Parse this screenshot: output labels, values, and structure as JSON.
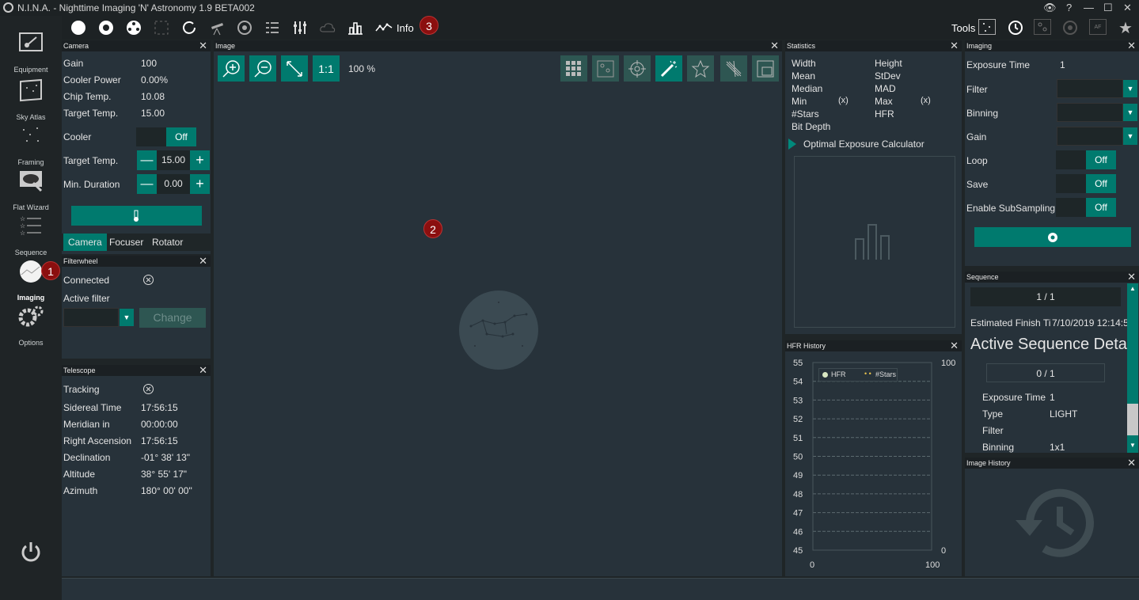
{
  "window": {
    "title": "N.I.N.A. - Nighttime Imaging 'N' Astronomy 1.9 BETA002",
    "controls": [
      "eye",
      "?",
      "—",
      "☐",
      "✕"
    ]
  },
  "sidebar": {
    "items": [
      {
        "label": "Equipment",
        "icon": "camera-plug-icon"
      },
      {
        "label": "Sky Atlas",
        "icon": "sky-atlas-icon"
      },
      {
        "label": "Framing",
        "icon": "framing-icon"
      },
      {
        "label": "Flat Wizard",
        "icon": "flat-wizard-icon"
      },
      {
        "label": "Sequence",
        "icon": "sequence-icon"
      },
      {
        "label": "Imaging",
        "icon": "imaging-icon"
      },
      {
        "label": "Options",
        "icon": "gears-icon"
      }
    ],
    "power_icon": "power-icon"
  },
  "toolbar": {
    "info_label": "Info",
    "tools_label": "Tools"
  },
  "badges": {
    "b1": "1",
    "b2": "2",
    "b3": "3"
  },
  "camera": {
    "title": "Camera",
    "rows": [
      {
        "k": "Gain",
        "v": "100"
      },
      {
        "k": "Cooler Power",
        "v": "0.00%"
      },
      {
        "k": "Chip Temp.",
        "v": "10.08"
      },
      {
        "k": "Target Temp.",
        "v": "15.00"
      }
    ],
    "cooler_label": "Cooler",
    "cooler_state": "Off",
    "target_label": "Target Temp.",
    "target_value": "15.00",
    "minduration_label": "Min. Duration",
    "minduration_value": "0.00",
    "tabs": [
      "Camera",
      "Focuser",
      "Rotator"
    ]
  },
  "filterwheel": {
    "title": "Filterwheel",
    "connected_label": "Connected",
    "active_label": "Active filter",
    "change_label": "Change"
  },
  "telescope": {
    "title": "Telescope",
    "rows": [
      {
        "k": "Tracking",
        "v": ""
      },
      {
        "k": "Sidereal Time",
        "v": "17:56:15"
      },
      {
        "k": "Meridian in",
        "v": "00:00:00"
      },
      {
        "k": "Right Ascension",
        "v": "17:56:15"
      },
      {
        "k": "Declination",
        "v": "-01° 38' 13\""
      },
      {
        "k": "Altitude",
        "v": "38° 55' 17\""
      },
      {
        "k": "Azimuth",
        "v": "180° 00' 00\""
      }
    ]
  },
  "image": {
    "title": "Image",
    "zoom_label": "1:1",
    "zoom_percent": "100 %"
  },
  "statistics": {
    "title": "Statistics",
    "left": [
      "Width",
      "Mean",
      "Median",
      "Min",
      "#Stars",
      "Bit Depth"
    ],
    "min_x": "(x)",
    "right": [
      "Height",
      "StDev",
      "MAD",
      "Max",
      "HFR"
    ],
    "max_x": "(x)",
    "calc_label": "Optimal Exposure Calculator"
  },
  "hfr": {
    "title": "HFR History",
    "legend": [
      "HFR",
      "#Stars"
    ]
  },
  "chart_data": {
    "type": "line",
    "title": "HFR History",
    "series": [
      {
        "name": "HFR",
        "values": []
      },
      {
        "name": "#Stars",
        "values": []
      }
    ],
    "y_ticks": [
      "55",
      "54",
      "53",
      "52",
      "51",
      "50",
      "49",
      "48",
      "47",
      "46",
      "45"
    ],
    "y2_ticks": [
      "100",
      "0"
    ],
    "x_ticks": [
      "0",
      "100"
    ],
    "ylim": [
      45,
      55
    ],
    "y2lim": [
      0,
      100
    ],
    "xlim": [
      0,
      100
    ],
    "grid": true,
    "legend": "top-left"
  },
  "imaging": {
    "title": "Imaging",
    "exposure_label": "Exposure Time",
    "exposure_value": "1",
    "filter_label": "Filter",
    "binning_label": "Binning",
    "gain_label": "Gain",
    "loop_label": "Loop",
    "save_label": "Save",
    "subsampling_label": "Enable SubSampling",
    "off": "Off"
  },
  "sequence": {
    "title": "Sequence",
    "counter": "1 / 1",
    "finish_label": "Estimated Finish Ti",
    "finish_value": "7/10/2019 12:14:5",
    "active_title": "Active Sequence Deta",
    "sub_counter": "0 / 1",
    "rows": [
      {
        "k": "Exposure Time",
        "v": "1"
      },
      {
        "k": "Type",
        "v": "LIGHT"
      },
      {
        "k": "Filter",
        "v": ""
      },
      {
        "k": "Binning",
        "v": "1x1"
      }
    ]
  },
  "image_history": {
    "title": "Image History"
  }
}
